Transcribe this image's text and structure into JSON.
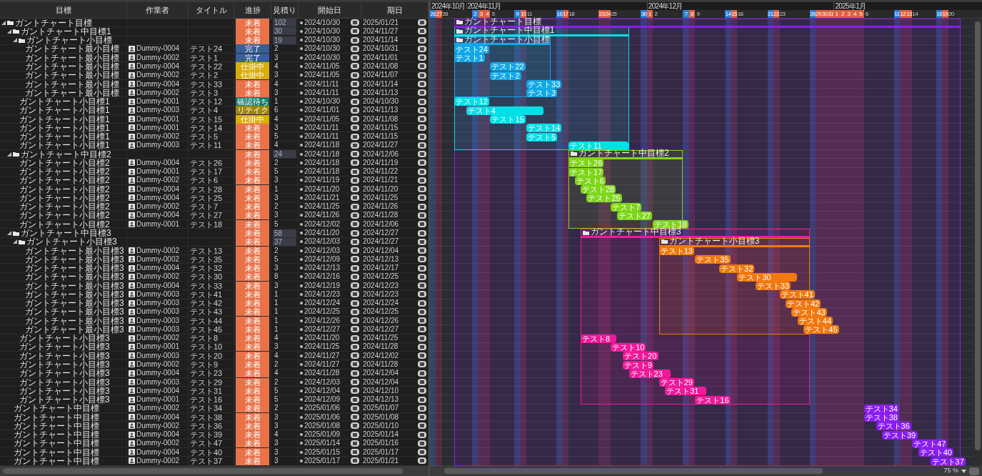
{
  "table": {
    "columns": [
      "目標",
      "作業者",
      "タイトル",
      "進捗",
      "見積り",
      "開始日",
      "期日"
    ]
  },
  "goals": [
    {
      "name": "ガントチャート目標",
      "bar_label": "ガントチャート目標",
      "expanded": true,
      "color": "#8a1ef0",
      "status": {
        "label": "未着",
        "color": "#e8734a"
      },
      "estimate": "102",
      "start": "2024/10/30",
      "end": "2025/01/21",
      "children": [
        {
          "name": "ガントチャート中目標1",
          "bar_label": "ガントチャート中目標1",
          "expanded": true,
          "color": "#00e0e6",
          "status": {
            "label": "未着",
            "color": "#e8734a"
          },
          "estimate": "30",
          "start": "2024/10/30",
          "end": "2024/11/27",
          "children": [
            {
              "name": "ガントチャート小目標",
              "bar_label": "ガントチャート小目標",
              "expanded": true,
              "color": "#12a8e8",
              "status": {
                "label": "未着",
                "color": "#e8734a"
              },
              "estimate": "19",
              "start": "2024/10/30",
              "end": "2024/11/14",
              "children": [
                {
                  "name": "ガントチャート最小目標",
                  "worker": "Dummy-0004",
                  "title": "テスト24",
                  "bar_label": "テスト24",
                  "status": {
                    "label": "完了",
                    "color": "#3a5f96"
                  },
                  "estimate": "2",
                  "start": "2024/10/30",
                  "end": "2024/10/31"
                },
                {
                  "name": "ガントチャート最小目標",
                  "worker": "Dummy-0002",
                  "title": "テスト1",
                  "bar_label": "テスト1",
                  "status": {
                    "label": "完了",
                    "color": "#3a5f96"
                  },
                  "estimate": "3",
                  "start": "2024/10/30",
                  "end": "2024/11/01"
                },
                {
                  "name": "ガントチャート最小目標",
                  "worker": "Dummy-0004",
                  "title": "テスト22",
                  "bar_label": "テスト22",
                  "status": {
                    "label": "仕掛中",
                    "color": "#d9ad0c"
                  },
                  "estimate": "4",
                  "start": "2024/11/05",
                  "end": "2024/11/08"
                },
                {
                  "name": "ガントチャート最小目標",
                  "worker": "Dummy-0002",
                  "title": "テスト2",
                  "bar_label": "テスト2",
                  "status": {
                    "label": "仕掛中",
                    "color": "#d9ad0c"
                  },
                  "estimate": "3",
                  "start": "2024/11/05",
                  "end": "2024/11/07"
                },
                {
                  "name": "ガントチャート最小目標",
                  "worker": "Dummy-0004",
                  "title": "テスト33",
                  "bar_label": "テスト33",
                  "status": {
                    "label": "未着",
                    "color": "#e8734a"
                  },
                  "estimate": "4",
                  "start": "2024/11/11",
                  "end": "2024/11/14"
                },
                {
                  "name": "ガントチャート最小目標",
                  "worker": "Dummy-0002",
                  "title": "テスト3",
                  "bar_label": "テスト3",
                  "status": {
                    "label": "未着",
                    "color": "#e8734a"
                  },
                  "estimate": "3",
                  "start": "2024/11/11",
                  "end": "2024/11/13"
                }
              ]
            },
            {
              "name": "ガントチャート小目標1",
              "worker": "Dummy-0001",
              "title": "テスト12",
              "bar_label": "テスト12",
              "status": {
                "label": "確認待ち",
                "color": "#127a6a"
              },
              "estimate": "1",
              "start": "2024/10/30",
              "end": "2024/10/30"
            },
            {
              "name": "ガントチャート小目標1",
              "worker": "Dummy-0003",
              "title": "テスト4",
              "bar_label": "テスト4",
              "status": {
                "label": "リテイク",
                "color": "#a08508"
              },
              "estimate": "6",
              "start": "2024/11/01",
              "end": "2024/11/13"
            },
            {
              "name": "ガントチャート小目標1",
              "worker": "Dummy-0001",
              "title": "テスト15",
              "bar_label": "テスト15",
              "status": {
                "label": "仕掛中",
                "color": "#d9ad0c"
              },
              "estimate": "4",
              "start": "2024/11/05",
              "end": "2024/11/08"
            },
            {
              "name": "ガントチャート小目標1",
              "worker": "Dummy-0001",
              "title": "テスト14",
              "bar_label": "テスト14",
              "status": {
                "label": "未着",
                "color": "#e8734a"
              },
              "estimate": "3",
              "start": "2024/11/11",
              "end": "2024/11/15"
            },
            {
              "name": "ガントチャート小目標1",
              "worker": "Dummy-0002",
              "title": "テスト5",
              "bar_label": "テスト5",
              "status": {
                "label": "未着",
                "color": "#e8734a"
              },
              "estimate": "5",
              "start": "2024/11/11",
              "end": "2024/11/15"
            },
            {
              "name": "ガントチャート小目標1",
              "worker": "Dummy-0003",
              "title": "テスト11",
              "bar_label": "テスト11",
              "status": {
                "label": "未着",
                "color": "#e8734a"
              },
              "estimate": "4",
              "start": "2024/11/18",
              "end": "2024/11/27"
            }
          ]
        },
        {
          "name": "ガントチャート中目標2",
          "bar_label": "ガントチャート中目標2",
          "expanded": true,
          "color": "#7fd61a",
          "status": {
            "label": "未着",
            "color": "#e8734a"
          },
          "estimate": "24",
          "start": "2024/11/18",
          "end": "2024/12/06",
          "children": [
            {
              "name": "ガントチャート小目標2",
              "worker": "Dummy-0004",
              "title": "テスト26",
              "bar_label": "テスト26",
              "status": {
                "label": "未着",
                "color": "#e8734a"
              },
              "estimate": "2",
              "start": "2024/11/18",
              "end": "2024/11/19"
            },
            {
              "name": "ガントチャート小目標2",
              "worker": "Dummy-0001",
              "title": "テスト17",
              "bar_label": "テスト17",
              "status": {
                "label": "未着",
                "color": "#e8734a"
              },
              "estimate": "5",
              "start": "2024/11/18",
              "end": "2024/11/22"
            },
            {
              "name": "ガントチャート小目標2",
              "worker": "Dummy-0002",
              "title": "テスト6",
              "bar_label": "テスト6",
              "status": {
                "label": "未着",
                "color": "#e8734a"
              },
              "estimate": "3",
              "start": "2024/11/19",
              "end": "2024/11/21"
            },
            {
              "name": "ガントチャート小目標2",
              "worker": "Dummy-0004",
              "title": "テスト28",
              "bar_label": "テスト28",
              "status": {
                "label": "未着",
                "color": "#e8734a"
              },
              "estimate": "1",
              "start": "2024/11/20",
              "end": "2024/11/20"
            },
            {
              "name": "ガントチャート小目標2",
              "worker": "Dummy-0004",
              "title": "テスト25",
              "bar_label": "テスト25",
              "status": {
                "label": "未着",
                "color": "#e8734a"
              },
              "estimate": "3",
              "start": "2024/11/21",
              "end": "2024/11/25"
            },
            {
              "name": "ガントチャート小目標2",
              "worker": "Dummy-0002",
              "title": "テスト7",
              "bar_label": "テスト7",
              "status": {
                "label": "未着",
                "color": "#e8734a"
              },
              "estimate": "2",
              "start": "2024/11/25",
              "end": "2024/11/26"
            },
            {
              "name": "ガントチャート小目標2",
              "worker": "Dummy-0004",
              "title": "テスト27",
              "bar_label": "テスト27",
              "status": {
                "label": "未着",
                "color": "#e8734a"
              },
              "estimate": "3",
              "start": "2024/11/26",
              "end": "2024/11/28"
            },
            {
              "name": "ガントチャート小目標2",
              "worker": "Dummy-0001",
              "title": "テスト18",
              "bar_label": "テスト18",
              "status": {
                "label": "未着",
                "color": "#e8734a"
              },
              "estimate": "5",
              "start": "2024/12/02",
              "end": "2024/12/06"
            }
          ]
        },
        {
          "name": "ガントチャート中目標3",
          "bar_label": "ガントチャート中目標3",
          "expanded": true,
          "color": "#ee1a9a",
          "status": {
            "label": "未着",
            "color": "#e8734a"
          },
          "estimate": "58",
          "start": "2024/11/20",
          "end": "2024/12/27",
          "children": [
            {
              "name": "ガントチャート小目標3",
              "bar_label": "ガントチャート小目標3",
              "expanded": true,
              "color": "#f07a10",
              "status": {
                "label": "未着",
                "color": "#e8734a"
              },
              "estimate": "37",
              "start": "2024/12/03",
              "end": "2024/12/27",
              "children": [
                {
                  "name": "ガントチャート最小目標3",
                  "worker": "Dummy-0002",
                  "title": "テスト13",
                  "bar_label": "テスト13",
                  "status": {
                    "label": "未着",
                    "color": "#e8734a"
                  },
                  "estimate": "2",
                  "start": "2024/12/03",
                  "end": "2024/12/04"
                },
                {
                  "name": "ガントチャート最小目標3",
                  "worker": "Dummy-0002",
                  "title": "テスト35",
                  "bar_label": "テスト35",
                  "status": {
                    "label": "未着",
                    "color": "#e8734a"
                  },
                  "estimate": "5",
                  "start": "2024/12/09",
                  "end": "2024/12/13"
                },
                {
                  "name": "ガントチャート最小目標3",
                  "worker": "Dummy-0004",
                  "title": "テスト32",
                  "bar_label": "テスト32",
                  "status": {
                    "label": "未着",
                    "color": "#e8734a"
                  },
                  "estimate": "3",
                  "start": "2024/12/13",
                  "end": "2024/12/17"
                },
                {
                  "name": "ガントチャート最小目標3",
                  "worker": "Dummy-0002",
                  "title": "テスト30",
                  "bar_label": "テスト30",
                  "status": {
                    "label": "未着",
                    "color": "#e8734a"
                  },
                  "estimate": "8",
                  "start": "2024/12/16",
                  "end": "2024/12/25"
                },
                {
                  "name": "ガントチャート最小目標3",
                  "worker": "Dummy-0004",
                  "title": "テスト33",
                  "bar_label": "テスト33",
                  "status": {
                    "label": "未着",
                    "color": "#e8734a"
                  },
                  "estimate": "3",
                  "start": "2024/12/19",
                  "end": "2024/12/23"
                },
                {
                  "name": "ガントチャート最小目標3",
                  "worker": "Dummy-0003",
                  "title": "テスト41",
                  "bar_label": "テスト41",
                  "status": {
                    "label": "未着",
                    "color": "#e8734a"
                  },
                  "estimate": "1",
                  "start": "2024/12/23",
                  "end": "2024/12/23"
                },
                {
                  "name": "ガントチャート最小目標3",
                  "worker": "Dummy-0003",
                  "title": "テスト42",
                  "bar_label": "テスト42",
                  "status": {
                    "label": "未着",
                    "color": "#e8734a"
                  },
                  "estimate": "1",
                  "start": "2024/12/24",
                  "end": "2024/12/24"
                },
                {
                  "name": "ガントチャート最小目標3",
                  "worker": "Dummy-0003",
                  "title": "テスト43",
                  "bar_label": "テスト43",
                  "status": {
                    "label": "未着",
                    "color": "#e8734a"
                  },
                  "estimate": "1",
                  "start": "2024/12/25",
                  "end": "2024/12/25"
                },
                {
                  "name": "ガントチャート最小目標3",
                  "worker": "Dummy-0003",
                  "title": "テスト44",
                  "bar_label": "テスト44",
                  "status": {
                    "label": "未着",
                    "color": "#e8734a"
                  },
                  "estimate": "1",
                  "start": "2024/12/26",
                  "end": "2024/12/26"
                },
                {
                  "name": "ガントチャート最小目標3",
                  "worker": "Dummy-0003",
                  "title": "テスト45",
                  "bar_label": "テスト45",
                  "status": {
                    "label": "未着",
                    "color": "#e8734a"
                  },
                  "estimate": "1",
                  "start": "2024/12/27",
                  "end": "2024/12/27"
                }
              ]
            },
            {
              "name": "ガントチャート小目標3",
              "worker": "Dummy-0002",
              "title": "テスト8",
              "bar_label": "テスト8",
              "status": {
                "label": "未着",
                "color": "#e8734a"
              },
              "estimate": "4",
              "start": "2024/11/20",
              "end": "2024/11/25"
            },
            {
              "name": "ガントチャート小目標3",
              "worker": "Dummy-0001",
              "title": "テスト10",
              "bar_label": "テスト10",
              "status": {
                "label": "未着",
                "color": "#e8734a"
              },
              "estimate": "3",
              "start": "2024/11/25",
              "end": "2024/11/28"
            },
            {
              "name": "ガントチャート小目標3",
              "worker": "Dummy-0003",
              "title": "テスト20",
              "bar_label": "テスト20",
              "status": {
                "label": "未着",
                "color": "#e8734a"
              },
              "estimate": "4",
              "start": "2024/11/27",
              "end": "2024/12/02"
            },
            {
              "name": "ガントチャート小目標3",
              "worker": "Dummy-0002",
              "title": "テスト9",
              "bar_label": "テスト9",
              "status": {
                "label": "未着",
                "color": "#e8734a"
              },
              "estimate": "2",
              "start": "2024/11/27",
              "end": "2024/11/28"
            },
            {
              "name": "ガントチャート小目標3",
              "worker": "Dummy-0004",
              "title": "テスト23",
              "bar_label": "テスト23",
              "status": {
                "label": "未着",
                "color": "#e8734a"
              },
              "estimate": "4",
              "start": "2024/11/28",
              "end": "2024/12/04"
            },
            {
              "name": "ガントチャート小目標3",
              "worker": "Dummy-0003",
              "title": "テスト29",
              "bar_label": "テスト29",
              "status": {
                "label": "未着",
                "color": "#e8734a"
              },
              "estimate": "2",
              "start": "2024/12/03",
              "end": "2024/12/04"
            },
            {
              "name": "ガントチャート小目標3",
              "worker": "Dummy-0004",
              "title": "テスト31",
              "bar_label": "テスト31",
              "status": {
                "label": "未着",
                "color": "#e8734a"
              },
              "estimate": "5",
              "start": "2024/12/04",
              "end": "2024/12/10"
            },
            {
              "name": "ガントチャート小目標3",
              "worker": "Dummy-0001",
              "title": "テスト16",
              "bar_label": "テスト16",
              "status": {
                "label": "未着",
                "color": "#e8734a"
              },
              "estimate": "5",
              "start": "2024/12/09",
              "end": "2024/12/13"
            }
          ]
        },
        {
          "name": "ガントチャート中目標",
          "worker": "Dummy-0002",
          "title": "テスト34",
          "bar_label": "テスト34",
          "status": {
            "label": "未着",
            "color": "#e8734a"
          },
          "estimate": "2",
          "start": "2025/01/06",
          "end": "2025/01/07"
        },
        {
          "name": "ガントチャート中目標",
          "worker": "Dummy-0004",
          "title": "テスト38",
          "bar_label": "テスト38",
          "status": {
            "label": "未着",
            "color": "#e8734a"
          },
          "estimate": "3",
          "start": "2025/01/06",
          "end": "2025/01/08"
        },
        {
          "name": "ガントチャート中目標",
          "worker": "Dummy-0002",
          "title": "テスト36",
          "bar_label": "テスト36",
          "status": {
            "label": "未着",
            "color": "#e8734a"
          },
          "estimate": "3",
          "start": "2025/01/08",
          "end": "2025/01/10"
        },
        {
          "name": "ガントチャート中目標",
          "worker": "Dummy-0004",
          "title": "テスト39",
          "bar_label": "テスト39",
          "status": {
            "label": "未着",
            "color": "#e8734a"
          },
          "estimate": "4",
          "start": "2025/01/09",
          "end": "2025/01/14"
        },
        {
          "name": "ガントチャート中目標",
          "worker": "Dummy-0002",
          "title": "テスト47",
          "bar_label": "テスト47",
          "status": {
            "label": "未着",
            "color": "#e8734a"
          },
          "estimate": "3",
          "start": "2025/01/14",
          "end": "2025/01/16"
        },
        {
          "name": "ガントチャート中目標",
          "worker": "Dummy-0004",
          "title": "テスト40",
          "bar_label": "テスト40",
          "status": {
            "label": "未着",
            "color": "#e8734a"
          },
          "estimate": "3",
          "start": "2025/01/15",
          "end": "2025/01/17"
        },
        {
          "name": "ガントチャート中目標",
          "worker": "Dummy-0002",
          "title": "テスト37",
          "bar_label": "テスト37",
          "status": {
            "label": "未着",
            "color": "#e8734a"
          },
          "estimate": "3",
          "start": "2025/01/17",
          "end": "2025/01/21"
        }
      ]
    }
  ],
  "gantt": {
    "months": [
      {
        "label": "2024年10月",
        "days": [
          {
            "kind": "sat",
            "label": "26"
          },
          {
            "kind": "sun",
            "label": "27"
          },
          {
            "kind": "weekday",
            "label": "28"
          },
          {
            "kind": "weekday"
          },
          {
            "kind": "weekday"
          },
          {
            "kind": "weekday"
          }
        ]
      },
      {
        "label": "2024年11月",
        "days": [
          {
            "kind": "weekday"
          },
          {
            "kind": "sat",
            "label": "2"
          },
          {
            "kind": "sun",
            "label": "3"
          },
          {
            "kind": "holiday",
            "label": "4"
          },
          {
            "kind": "weekday",
            "label": "5"
          },
          {
            "kind": "weekday"
          },
          {
            "kind": "weekday"
          },
          {
            "kind": "weekday"
          },
          {
            "kind": "sat",
            "label": "9"
          },
          {
            "kind": "sun",
            "label": "10"
          },
          {
            "kind": "weekday",
            "label": "11"
          },
          {
            "kind": "weekday"
          },
          {
            "kind": "weekday"
          },
          {
            "kind": "weekday"
          },
          {
            "kind": "weekday"
          },
          {
            "kind": "sat",
            "label": "16"
          },
          {
            "kind": "sun",
            "label": "17"
          },
          {
            "kind": "weekday",
            "label": "18"
          },
          {
            "kind": "weekday"
          },
          {
            "kind": "weekday"
          },
          {
            "kind": "weekday"
          },
          {
            "kind": "weekday"
          },
          {
            "kind": "holiday",
            "label": "23"
          },
          {
            "kind": "sun",
            "label": "24"
          },
          {
            "kind": "weekday",
            "label": "25"
          },
          {
            "kind": "weekday"
          },
          {
            "kind": "weekday"
          },
          {
            "kind": "weekday"
          },
          {
            "kind": "weekday"
          },
          {
            "kind": "sat",
            "label": "30"
          }
        ]
      },
      {
        "label": "2024年12月",
        "days": [
          {
            "kind": "sun",
            "label": "1"
          },
          {
            "kind": "weekday",
            "label": "2"
          },
          {
            "kind": "weekday"
          },
          {
            "kind": "weekday"
          },
          {
            "kind": "weekday"
          },
          {
            "kind": "weekday"
          },
          {
            "kind": "sat",
            "label": "7"
          },
          {
            "kind": "sun",
            "label": "8"
          },
          {
            "kind": "weekday",
            "label": "9"
          },
          {
            "kind": "weekday"
          },
          {
            "kind": "weekday"
          },
          {
            "kind": "weekday"
          },
          {
            "kind": "weekday"
          },
          {
            "kind": "sat",
            "label": "14"
          },
          {
            "kind": "sun",
            "label": "15"
          },
          {
            "kind": "weekday",
            "label": "16"
          },
          {
            "kind": "weekday"
          },
          {
            "kind": "weekday"
          },
          {
            "kind": "weekday"
          },
          {
            "kind": "weekday"
          },
          {
            "kind": "sat",
            "label": "21"
          },
          {
            "kind": "sun",
            "label": "22"
          },
          {
            "kind": "weekday",
            "label": "23"
          },
          {
            "kind": "weekday"
          },
          {
            "kind": "weekday"
          },
          {
            "kind": "weekday"
          },
          {
            "kind": "weekday"
          },
          {
            "kind": "sat",
            "label": "28"
          },
          {
            "kind": "sun",
            "label": "29"
          },
          {
            "kind": "holiday",
            "label": "30"
          },
          {
            "kind": "holiday",
            "label": "31"
          }
        ]
      },
      {
        "label": "2025年1月",
        "days": [
          {
            "kind": "holiday",
            "label": "1"
          },
          {
            "kind": "holiday",
            "label": "2"
          },
          {
            "kind": "holiday",
            "label": "3"
          },
          {
            "kind": "holiday",
            "label": "4"
          },
          {
            "kind": "sun",
            "label": "5"
          },
          {
            "kind": "weekday",
            "label": "6"
          },
          {
            "kind": "weekday"
          },
          {
            "kind": "weekday"
          },
          {
            "kind": "weekday"
          },
          {
            "kind": "weekday"
          },
          {
            "kind": "sat",
            "label": "11"
          },
          {
            "kind": "sun",
            "label": "12"
          },
          {
            "kind": "holiday",
            "label": "13"
          },
          {
            "kind": "weekday",
            "label": "14"
          },
          {
            "kind": "weekday"
          },
          {
            "kind": "weekday"
          },
          {
            "kind": "weekday"
          },
          {
            "kind": "sat",
            "label": "18"
          },
          {
            "kind": "sun",
            "label": "19"
          },
          {
            "kind": "weekday",
            "label": "20"
          },
          {
            "kind": "weekday"
          },
          {
            "kind": "weekday"
          },
          {
            "kind": "weekday"
          }
        ]
      }
    ],
    "zoom": "75 %"
  }
}
